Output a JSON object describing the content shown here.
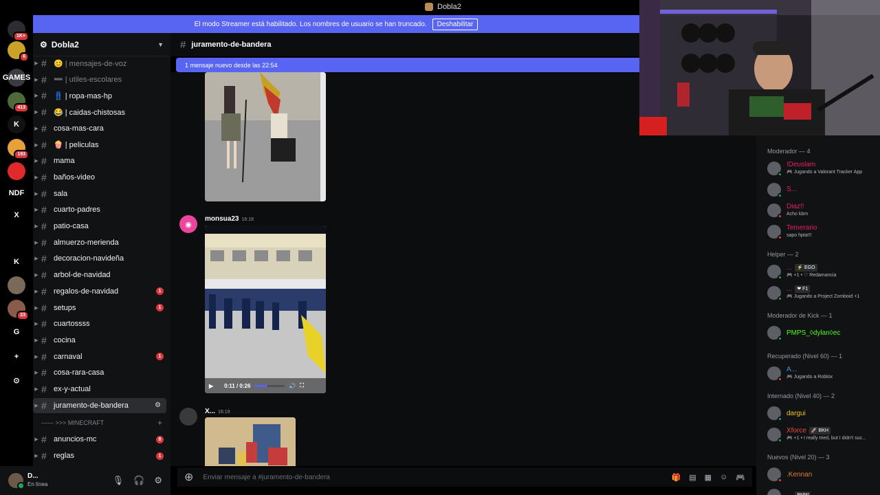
{
  "window": {
    "title": "Dobla2"
  },
  "banner": {
    "text": "El modo Streamer está habilitado. Los nombres de usuario se han truncado.",
    "button": "Deshabilitar"
  },
  "guilds": [
    {
      "label": "",
      "badge": "1K+",
      "color": "#2b2d31"
    },
    {
      "label": "",
      "badge": "6",
      "color": "#c9a227"
    },
    {
      "label": "GAMES",
      "badge": "",
      "color": "#3a3c42"
    },
    {
      "label": "",
      "badge": "413",
      "color": "#4e6a3a"
    },
    {
      "label": "K",
      "badge": "",
      "color": "#111214"
    },
    {
      "label": "",
      "badge": "193",
      "color": "#e8a13a"
    },
    {
      "label": "",
      "badge": "",
      "color": "#e0292b"
    },
    {
      "label": "NDF",
      "badge": "",
      "color": "#000000"
    },
    {
      "label": "X",
      "badge": "",
      "color": "#000000"
    },
    {
      "label": "",
      "badge": "",
      "color": "#000000"
    },
    {
      "label": "K",
      "badge": "",
      "color": "#000000"
    },
    {
      "label": "",
      "badge": "",
      "color": "#7a6a5a"
    },
    {
      "label": "",
      "badge": "23",
      "color": "#8a5a4a"
    },
    {
      "label": "G",
      "badge": "",
      "color": "#000000"
    },
    {
      "label": "+",
      "badge": "",
      "color": "#000000"
    },
    {
      "label": "⊙",
      "badge": "",
      "color": "#000000"
    }
  ],
  "server": {
    "name": "Dobla2"
  },
  "channels": [
    {
      "label": "😊 | mensajes-de-voz",
      "muted": true,
      "unread": ""
    },
    {
      "label": "➖ | utiles-escolares",
      "muted": true,
      "unread": ""
    },
    {
      "label": "👖 | ropa-mas-hp",
      "muted": false,
      "unread": ""
    },
    {
      "label": "😂 | caidas-chistosas",
      "muted": false,
      "unread": ""
    },
    {
      "label": "cosa-mas-cara",
      "muted": false,
      "unread": ""
    },
    {
      "label": "🍿 | peliculas",
      "muted": false,
      "unread": ""
    },
    {
      "label": "mama",
      "muted": false,
      "unread": ""
    },
    {
      "label": "baños-video",
      "muted": false,
      "unread": ""
    },
    {
      "label": "sala",
      "muted": false,
      "unread": ""
    },
    {
      "label": "cuarto-padres",
      "muted": false,
      "unread": ""
    },
    {
      "label": "patio-casa",
      "muted": false,
      "unread": ""
    },
    {
      "label": "almuerzo-merienda",
      "muted": false,
      "unread": ""
    },
    {
      "label": "decoracion-navideña",
      "muted": false,
      "unread": ""
    },
    {
      "label": "arbol-de-navidad",
      "muted": false,
      "unread": ""
    },
    {
      "label": "regalos-de-navidad",
      "muted": false,
      "unread": "1"
    },
    {
      "label": "setups",
      "muted": false,
      "unread": "1"
    },
    {
      "label": "cuartossss",
      "muted": false,
      "unread": ""
    },
    {
      "label": "cocina",
      "muted": false,
      "unread": ""
    },
    {
      "label": "carnaval",
      "muted": false,
      "unread": "1"
    },
    {
      "label": "cosa-rara-casa",
      "muted": false,
      "unread": ""
    },
    {
      "label": "ex-y-actual",
      "muted": false,
      "unread": ""
    },
    {
      "label": "juramento-de-bandera",
      "muted": false,
      "unread": "",
      "active": true
    }
  ],
  "category": {
    "label": "------ >>> MINECRAFT"
  },
  "channels2": [
    {
      "label": "anuncios-mc",
      "unread": "8"
    },
    {
      "label": "reglas",
      "unread": "1"
    }
  ],
  "user": {
    "name": "D...",
    "status": "En línea"
  },
  "chat": {
    "channel": "juramento-de-bandera",
    "new_messages": "1 mensaje nuevo desde las 22:54",
    "messages": [
      {
        "author": "monsua23",
        "time": "16:18",
        "video_time": "0:11 / 0:26",
        "video_progress": 0.42
      },
      {
        "author": "X...",
        "time": "16:19"
      }
    ],
    "composer_placeholder": "Enviar mensaje a #juramento-de-bandera"
  },
  "members": {
    "groups": [
      {
        "title": "Moderador — 4",
        "items": [
          {
            "name": "!Deuslam",
            "sub": "🎮 Jugando a Valorant Tracker App",
            "color": "#e91e63",
            "status": "#23a55a",
            "tag": ""
          },
          {
            "name": "S...",
            "sub": "",
            "color": "#e91e63",
            "status": "#23a55a",
            "tag": ""
          },
          {
            "name": "Diaz!!",
            "sub": "Acho kbrn",
            "color": "#e91e63",
            "status": "#f23f43",
            "tag": ""
          },
          {
            "name": "Temerario",
            "sub": "sapo hpta!!!",
            "color": "#e91e63",
            "status": "#f23f43",
            "tag": ""
          }
        ]
      },
      {
        "title": "Helper — 2",
        "items": [
          {
            "name": "...",
            "sub": "🎮 +1 • ♡ Redamancia",
            "color": "#e91e63",
            "status": "#23a55a",
            "tag": "⚡ EGO"
          },
          {
            "name": "...",
            "sub": "🎮 Jugando a Project Zomboid +1",
            "color": "#e91e63",
            "status": "#23a55a",
            "tag": "❤ F1"
          }
        ]
      },
      {
        "title": "Moderador de Kick — 1",
        "items": [
          {
            "name": "PMPS_◊dylan◊ec",
            "sub": "",
            "color": "#53fc18",
            "status": "#23a55a",
            "tag": ""
          }
        ]
      },
      {
        "title": "Recuperado (Nivel 60) — 1",
        "items": [
          {
            "name": "A...",
            "sub": "🎮 Jugando a Roblox",
            "color": "#3498db",
            "status": "#f23f43",
            "tag": ""
          }
        ]
      },
      {
        "title": "Internado (Nivel 40) — 2",
        "items": [
          {
            "name": "dargui",
            "sub": "",
            "color": "#f1c40f",
            "status": "#23a55a",
            "tag": ""
          },
          {
            "name": "Xforce",
            "sub": "🎮 +1 • I really tried, but I didn't suc...",
            "color": "#e74c3c",
            "status": "#23a55a",
            "tag": "🚀 BKH"
          }
        ]
      },
      {
        "title": "Nuevos (Nivel 20) — 3",
        "items": [
          {
            "name": ".Kennan",
            "sub": "",
            "color": "#e67e22",
            "status": "#f23f43",
            "tag": ""
          },
          {
            "name": "...",
            "sub": "",
            "color": "#e74c3c",
            "status": "#23a55a",
            "tag": "BMW"
          }
        ]
      }
    ]
  }
}
